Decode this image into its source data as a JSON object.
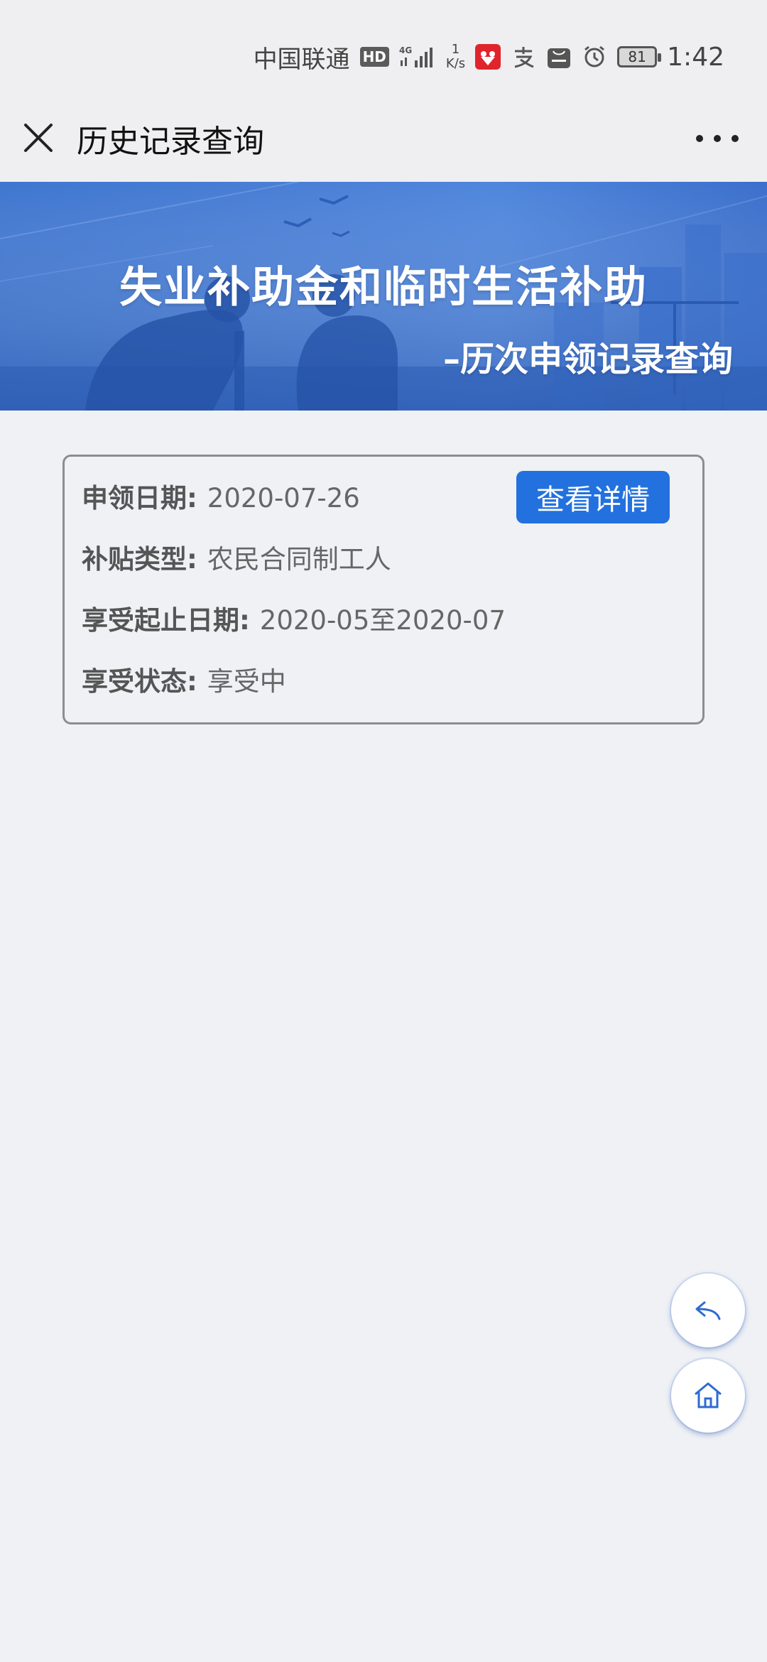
{
  "status_bar": {
    "carrier": "中国联通",
    "hd": "HD",
    "network": "4G",
    "speed_value": "1",
    "speed_unit": "K/s",
    "battery": "81",
    "time": "1:42"
  },
  "title_bar": {
    "title": "历史记录查询"
  },
  "banner": {
    "title": "失业补助金和临时生活补助",
    "subtitle": "–历次申领记录查询"
  },
  "record": {
    "apply_date_label": "申领日期:",
    "apply_date_value": "2020-07-26",
    "subsidy_type_label": "补贴类型:",
    "subsidy_type_value": "农民合同制工人",
    "period_label": "享受起止日期:",
    "period_value": "2020-05至2020-07",
    "status_label": "享受状态:",
    "status_value": "享受中",
    "detail_button": "查看详情"
  },
  "colors": {
    "accent": "#2271df",
    "background": "#eff1f5",
    "banner": "#4a7fd6"
  },
  "icons": {
    "close": "close-icon",
    "more": "more-icon",
    "back": "back-arrow-icon",
    "home": "home-icon"
  }
}
